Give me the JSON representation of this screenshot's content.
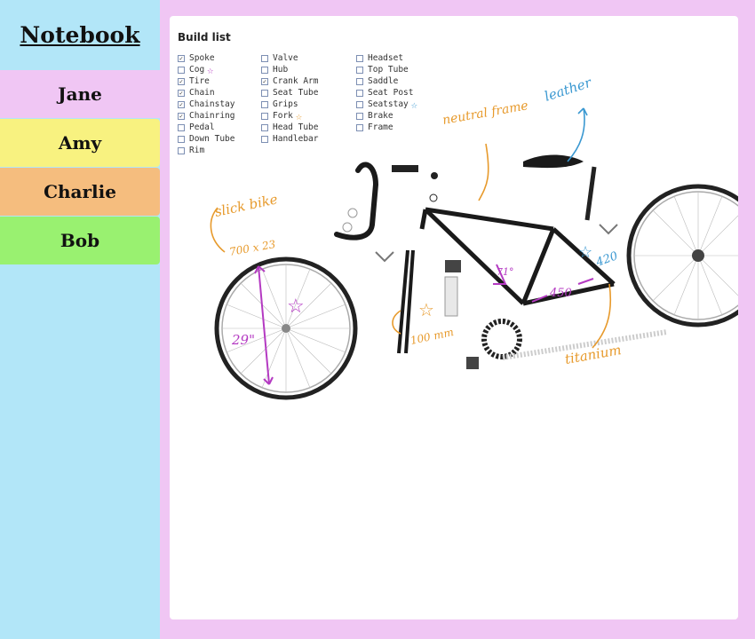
{
  "app": {
    "title": "Notebook"
  },
  "tabs": [
    "Jane",
    "Amy",
    "Charlie",
    "Bob"
  ],
  "build_list": {
    "title": "Build list",
    "columns": [
      [
        {
          "label": "Spoke",
          "checked": true
        },
        {
          "label": "Cog",
          "checked": false,
          "star": "purple"
        },
        {
          "label": "Tire",
          "checked": true
        },
        {
          "label": "Chain",
          "checked": true
        },
        {
          "label": "Chainstay",
          "checked": true
        },
        {
          "label": "Chainring",
          "checked": true
        },
        {
          "label": "Pedal",
          "checked": false
        },
        {
          "label": "Down Tube",
          "checked": false
        },
        {
          "label": "Rim",
          "checked": false
        }
      ],
      [
        {
          "label": "Valve",
          "checked": false
        },
        {
          "label": "Hub",
          "checked": false
        },
        {
          "label": "Crank Arm",
          "checked": true
        },
        {
          "label": "Seat Tube",
          "checked": false
        },
        {
          "label": "Grips",
          "checked": false
        },
        {
          "label": "Fork",
          "checked": false,
          "star": "orange"
        },
        {
          "label": "Head Tube",
          "checked": false
        },
        {
          "label": "Handlebar",
          "checked": false
        }
      ],
      [
        {
          "label": "Headset",
          "checked": false
        },
        {
          "label": "Top Tube",
          "checked": false
        },
        {
          "label": "Saddle",
          "checked": false
        },
        {
          "label": "Seat Post",
          "checked": false
        },
        {
          "label": "Seatstay",
          "checked": false,
          "star": "blue"
        },
        {
          "label": "Brake",
          "checked": false
        },
        {
          "label": "Frame",
          "checked": false
        }
      ]
    ]
  },
  "annotations": {
    "neutral_frame": "neutral frame",
    "leather": "leather",
    "slick_bike": "slick bike",
    "tire_size": "700 x 23",
    "wheel_size": "29\"",
    "angle": "71°",
    "frame_length": "450",
    "seat_length": "420",
    "fork_length": "100 mm",
    "titanium": "titanium"
  },
  "colors": {
    "sidebar": "#b2e6f8",
    "jane": "#f0c6f4",
    "amy": "#f8f280",
    "charlie": "#f5bd7e",
    "bob": "#99f170",
    "purple_ink": "#b43ac2",
    "orange_ink": "#e79a2c",
    "blue_ink": "#3a98d1"
  }
}
